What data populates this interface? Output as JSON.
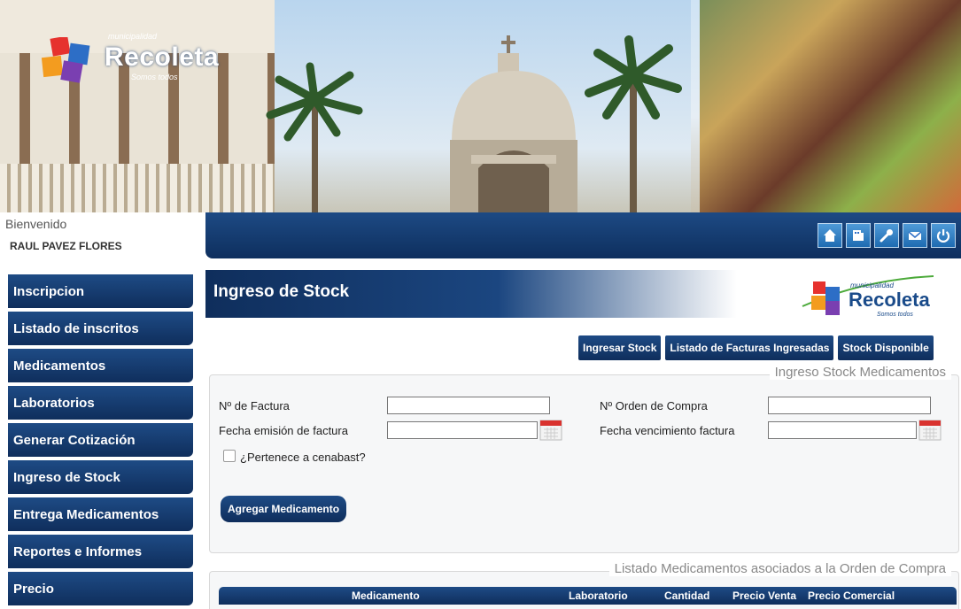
{
  "header": {
    "logo_small": "municipalidad",
    "logo_name": "Recoleta",
    "logo_tagline": "Somos todos"
  },
  "welcome": {
    "greeting": "Bienvenido",
    "user": "RAUL PAVEZ FLORES"
  },
  "topbar": {
    "icons": [
      "home-icon",
      "keyboard-icon",
      "wrench-icon",
      "mail-icon",
      "power-icon"
    ]
  },
  "sidebar": {
    "items": [
      {
        "label": "Inscripcion"
      },
      {
        "label": "Listado de inscritos"
      },
      {
        "label": "Medicamentos"
      },
      {
        "label": "Laboratorios"
      },
      {
        "label": "Generar Cotización"
      },
      {
        "label": "Ingreso de Stock"
      },
      {
        "label": "Entrega Medicamentos"
      },
      {
        "label": "Reportes e Informes"
      },
      {
        "label": "Precio"
      }
    ]
  },
  "page": {
    "title": "Ingreso de Stock"
  },
  "tabs": [
    {
      "label": "Ingresar Stock"
    },
    {
      "label": "Listado de Facturas Ingresadas"
    },
    {
      "label": "Stock Disponible"
    }
  ],
  "form": {
    "legend": "Ingreso Stock Medicamentos",
    "factura_label": "Nº de Factura",
    "factura_value": "",
    "orden_label": "Nº Orden de Compra",
    "orden_value": "",
    "emision_label": "Fecha emisión de factura",
    "emision_value": "",
    "vencimiento_label": "Fecha vencimiento factura",
    "vencimiento_value": "",
    "cenabast_label": "¿Pertenece a cenabast?",
    "cenabast_checked": false,
    "add_button": "Agregar Medicamento"
  },
  "listado": {
    "legend": "Listado Medicamentos asociados a la Orden de Compra",
    "columns": [
      "Medicamento",
      "Laboratorio",
      "Cantidad",
      "Precio Venta",
      "Precio Comercial"
    ]
  }
}
